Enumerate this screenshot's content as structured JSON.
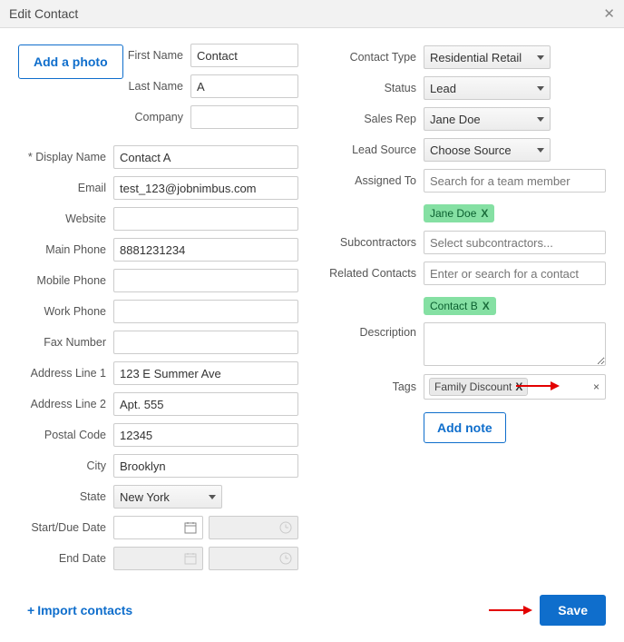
{
  "window": {
    "title": "Edit Contact"
  },
  "buttons": {
    "add_photo": "Add a photo",
    "add_note": "Add note",
    "save": "Save",
    "import": "Import contacts"
  },
  "labels": {
    "first_name": "First Name",
    "last_name": "Last Name",
    "company": "Company",
    "display_name": "* Display Name",
    "email": "Email",
    "website": "Website",
    "main_phone": "Main Phone",
    "mobile_phone": "Mobile Phone",
    "work_phone": "Work Phone",
    "fax_number": "Fax Number",
    "address1": "Address Line 1",
    "address2": "Address Line 2",
    "postal_code": "Postal Code",
    "city": "City",
    "state": "State",
    "start_date": "Start/Due Date",
    "end_date": "End Date",
    "contact_type": "Contact Type",
    "status": "Status",
    "sales_rep": "Sales Rep",
    "lead_source": "Lead Source",
    "assigned_to": "Assigned To",
    "subcontractors": "Subcontractors",
    "related_contacts": "Related Contacts",
    "description": "Description",
    "tags": "Tags"
  },
  "values": {
    "first_name": "Contact",
    "last_name": "A",
    "company": "",
    "display_name": "Contact A",
    "email": "test_123@jobnimbus.com",
    "website": "",
    "main_phone": "8881231234",
    "mobile_phone": "",
    "work_phone": "",
    "fax_number": "",
    "address1": "123 E Summer Ave",
    "address2": "Apt. 555",
    "postal_code": "12345",
    "city": "Brooklyn",
    "state": "New York",
    "contact_type": "Residential Retail",
    "status": "Lead",
    "sales_rep": "Jane Doe",
    "lead_source": "Choose Source",
    "description": ""
  },
  "placeholders": {
    "assigned_to": "Search for a team member",
    "subcontractors": "Select subcontractors...",
    "related_contacts": "Enter or search for a contact"
  },
  "chips": {
    "assigned_to": "Jane Doe",
    "related_contact": "Contact B",
    "tag": "Family Discount",
    "remove_x": "X",
    "remove_sym": "×"
  }
}
